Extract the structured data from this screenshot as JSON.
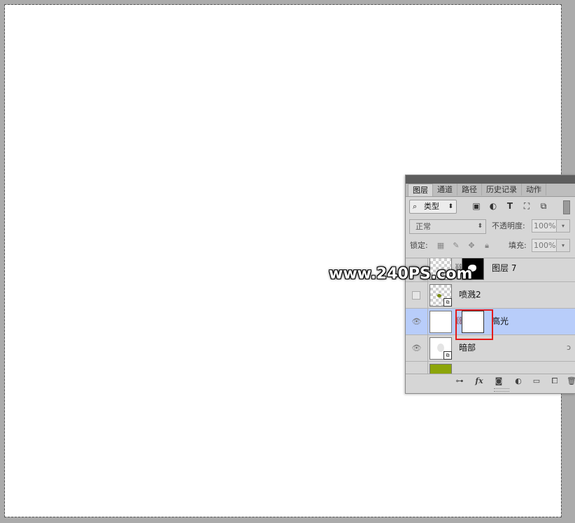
{
  "panel": {
    "tabs": [
      "图层",
      "通道",
      "路径",
      "历史记录",
      "动作"
    ],
    "active_tab": "图层",
    "filter": {
      "label": "类型"
    },
    "blend_mode": "正常",
    "opacity_label": "不透明度:",
    "opacity_value": "100%",
    "lock_label": "锁定:",
    "fill_label": "填充:",
    "fill_value": "100%",
    "layers": [
      {
        "name": "图层 7",
        "visible": false,
        "has_mask": true,
        "selected": false
      },
      {
        "name": "喷溅2",
        "visible": false,
        "smart_object": true,
        "selected": false
      },
      {
        "name": "高光",
        "visible": true,
        "has_mask": true,
        "selected": true
      },
      {
        "name": "暗部",
        "visible": true,
        "smart_object": true,
        "selected": false
      },
      {
        "name": "",
        "visible": false,
        "partial": true,
        "thumb_color": "#8ca50a"
      }
    ]
  },
  "watermark": "www.240PS.com",
  "colors": {
    "selection": "#b8cdfa",
    "highlight_box": "#e31b1b"
  }
}
